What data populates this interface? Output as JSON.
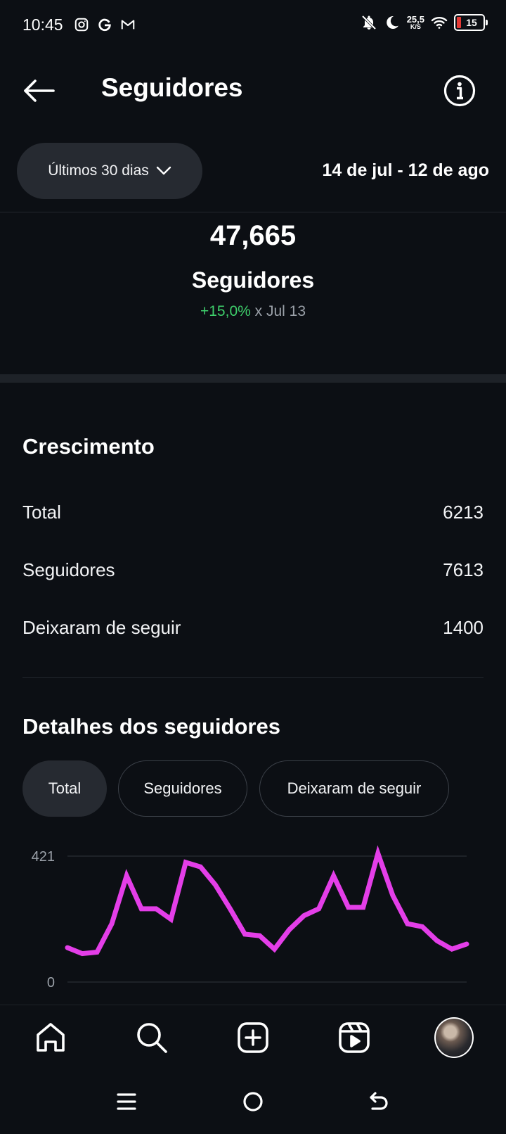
{
  "status_bar": {
    "time": "10:45",
    "net_speed_value": "25,5",
    "net_speed_unit": "K/S",
    "battery_level": "15"
  },
  "header": {
    "title": "Seguidores"
  },
  "filter": {
    "range_label": "Últimos 30 dias",
    "date_range": "14 de jul - 12 de ago"
  },
  "summary": {
    "count": "47,665",
    "label": "Seguidores",
    "delta_pct": "+15,0%",
    "delta_compare": "x Jul 13"
  },
  "growth": {
    "title": "Crescimento",
    "rows": [
      {
        "label": "Total",
        "value": "6213"
      },
      {
        "label": "Seguidores",
        "value": "7613"
      },
      {
        "label": "Deixaram de seguir",
        "value": "1400"
      }
    ]
  },
  "details": {
    "title": "Detalhes dos seguidores",
    "tabs": [
      {
        "label": "Total",
        "active": true
      },
      {
        "label": "Seguidores",
        "active": false
      },
      {
        "label": "Deixaram de seguir",
        "active": false
      }
    ]
  },
  "chart_data": {
    "type": "line",
    "ylim": [
      0,
      421
    ],
    "y_ticks": [
      "421",
      "0"
    ],
    "color": "#e43ee8",
    "x": [
      1,
      2,
      3,
      4,
      5,
      6,
      7,
      8,
      9,
      10,
      11,
      12,
      13,
      14,
      15,
      16,
      17,
      18,
      19,
      20,
      21,
      22,
      23,
      24,
      25,
      26,
      27,
      28
    ],
    "values": [
      115,
      95,
      100,
      195,
      355,
      245,
      245,
      210,
      400,
      385,
      325,
      245,
      160,
      155,
      110,
      175,
      222,
      245,
      355,
      250,
      250,
      430,
      290,
      195,
      185,
      138,
      110,
      127
    ]
  },
  "bottom_nav": {
    "items": [
      "home-icon",
      "search-icon",
      "create-icon",
      "reels-icon",
      "profile-avatar"
    ]
  }
}
